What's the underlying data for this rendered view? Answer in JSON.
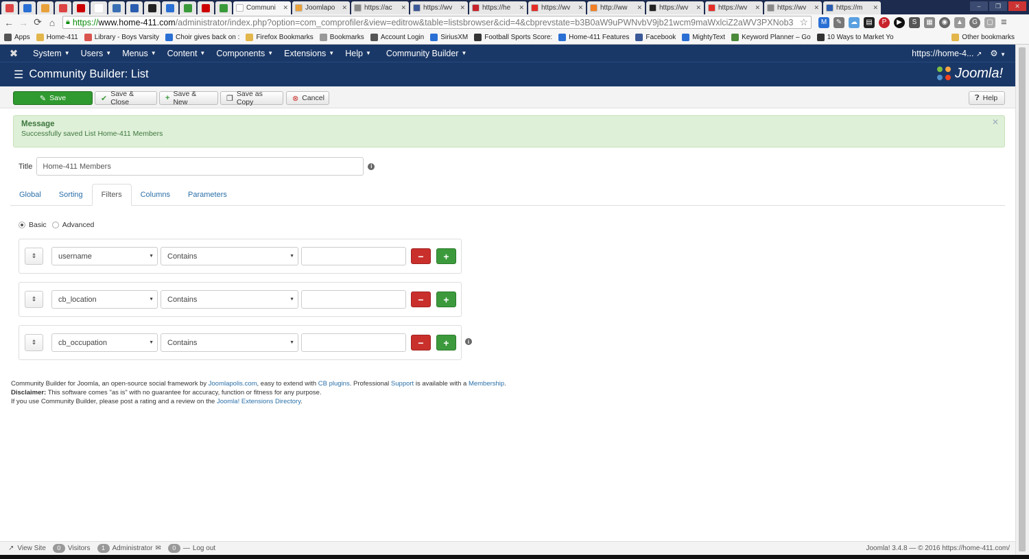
{
  "browser": {
    "pinned_tabs": [
      "#d44",
      "#2a6fd4",
      "#e9a13b",
      "#d44",
      "#c00",
      "#fff",
      "#3a6fb4",
      "#2a5db0",
      "#222",
      "#2a6fd4",
      "#3a9a3a",
      "#c00",
      "#3a9a3a"
    ],
    "tabs": [
      {
        "title": "Communi",
        "color": "#fff",
        "active": true
      },
      {
        "title": "Joomlapo",
        "color": "#e9a13b"
      },
      {
        "title": "https://ac",
        "color": "#888"
      },
      {
        "title": "https://wv",
        "color": "#3b5998"
      },
      {
        "title": "https://he",
        "color": "#c8232c"
      },
      {
        "title": "https://wv",
        "color": "#e52d27"
      },
      {
        "title": "http://ww",
        "color": "#f48024"
      },
      {
        "title": "https://wv",
        "color": "#222"
      },
      {
        "title": "https://wv",
        "color": "#e52d27"
      },
      {
        "title": "https://wv",
        "color": "#888"
      },
      {
        "title": "https://m",
        "color": "#2a5db0"
      }
    ],
    "url": {
      "scheme": "https://",
      "host": "www.home-411.com",
      "path": "/administrator/index.php?option=com_comprofiler&view=editrow&table=listsbrowser&cid=4&cbprevstate=b3B0aW9uPWNvbV9jb21wcm9maWxlciZ2aWV3PXNob3"
    },
    "bookmarks": [
      {
        "label": "Apps",
        "color": "#555"
      },
      {
        "label": "Home-411",
        "color": "#e2b64b"
      },
      {
        "label": "Library - Boys Varsity",
        "color": "#d9534f"
      },
      {
        "label": "Choir gives back on :",
        "color": "#2a6fd4"
      },
      {
        "label": "Firefox Bookmarks",
        "color": "#e2b64b"
      },
      {
        "label": "Bookmarks",
        "color": "#999"
      },
      {
        "label": "Account Login",
        "color": "#555"
      },
      {
        "label": "SiriusXM",
        "color": "#2a6fd4"
      },
      {
        "label": "Football Sports Score:",
        "color": "#333"
      },
      {
        "label": "Home-411 Features",
        "color": "#2a6fd4"
      },
      {
        "label": "Facebook",
        "color": "#3b5998"
      },
      {
        "label": "MightyText",
        "color": "#2a6fd4"
      },
      {
        "label": "Keyword Planner – Go",
        "color": "#4a8a3a"
      },
      {
        "label": "10 Ways to Market Yo",
        "color": "#333"
      }
    ],
    "other_bookmarks": "Other bookmarks"
  },
  "admin_nav": {
    "menus": [
      "System",
      "Users",
      "Menus",
      "Content",
      "Components",
      "Extensions",
      "Help",
      "Community Builder"
    ],
    "site_link": "https://home-4..."
  },
  "page": {
    "title": "Community Builder: List",
    "brand": "Joomla!"
  },
  "toolbar": {
    "save": "Save",
    "save_close": "Save & Close",
    "save_new": "Save & New",
    "save_copy": "Save as Copy",
    "cancel": "Cancel",
    "help": "Help"
  },
  "message": {
    "heading": "Message",
    "body": "Successfully saved List Home-411 Members"
  },
  "form": {
    "title_label": "Title",
    "title_value": "Home-411 Members",
    "tabs": [
      "Global",
      "Sorting",
      "Filters",
      "Columns",
      "Parameters"
    ],
    "active_tab": "Filters",
    "mode_basic": "Basic",
    "mode_advanced": "Advanced",
    "filters": [
      {
        "field": "username",
        "operator": "Contains",
        "value": ""
      },
      {
        "field": "cb_location",
        "operator": "Contains",
        "value": ""
      },
      {
        "field": "cb_occupation",
        "operator": "Contains",
        "value": ""
      }
    ]
  },
  "footer": {
    "line1_a": "Community Builder for Joomla, an open-source social framework by ",
    "link_joomlapolis": "Joomlapolis.com",
    "line1_b": ", easy to extend with ",
    "link_plugins": "CB plugins",
    "line1_c": ". Professional ",
    "link_support": "Support",
    "line1_d": " is available with a ",
    "link_membership": "Membership",
    "line1_e": ".",
    "disclaimer_label": "Disclaimer:",
    "disclaimer_text": " This software comes \"as is\" with no guarantee for accuracy, function or fitness for any purpose.",
    "line3_a": "If you use Community Builder, please post a rating and a review on the ",
    "link_jed": "Joomla! Extensions Directory",
    "line3_b": "."
  },
  "status": {
    "view_site": "View Site",
    "visitors_count": "0",
    "visitors": "Visitors",
    "admin_count": "1",
    "administrator": "Administrator",
    "msg_count": "0",
    "logout": "Log out",
    "version": "Joomla! 3.4.8 — © 2016 https://home-411.com/"
  }
}
